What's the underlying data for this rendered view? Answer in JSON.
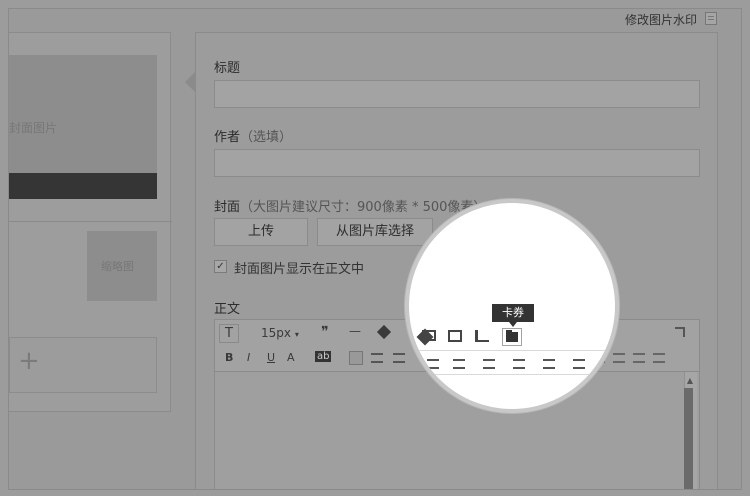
{
  "header": {
    "watermark_link": "修改图片水印"
  },
  "left_panel": {
    "cover_placeholder": "封面图片",
    "thumb_placeholder": "缩略图",
    "add_symbol": "+"
  },
  "form": {
    "title_label": "标题",
    "author_label": "作者",
    "author_hint": "（选填）",
    "cover_label": "封面",
    "cover_hint": "（大图片建议尺寸：900像素 * 500像素）",
    "upload_button": "上传",
    "library_button": "从图片库选择",
    "show_in_body_label": "封面图片显示在正文中",
    "show_in_body_checked": true,
    "body_label": "正文"
  },
  "toolbar": {
    "font_size": "15px",
    "font_size_arrow": "▾",
    "quote_symbol": "❞",
    "dash_symbol": "—",
    "tooltip_card": "卡券",
    "row2": {
      "bold": "B",
      "italic": "I",
      "underline": "U",
      "font_color": "A",
      "bg_color": "ab"
    }
  },
  "icons": {
    "watermark": "document-icon",
    "text_format": "text-format-icon",
    "quote": "quote-icon",
    "horizontal_rule": "horizontal-rule-icon",
    "eraser": "eraser-icon",
    "video": "video-icon",
    "image": "image-icon",
    "vote": "vote-icon",
    "card": "card-icon",
    "fullscreen": "fullscreen-icon"
  }
}
